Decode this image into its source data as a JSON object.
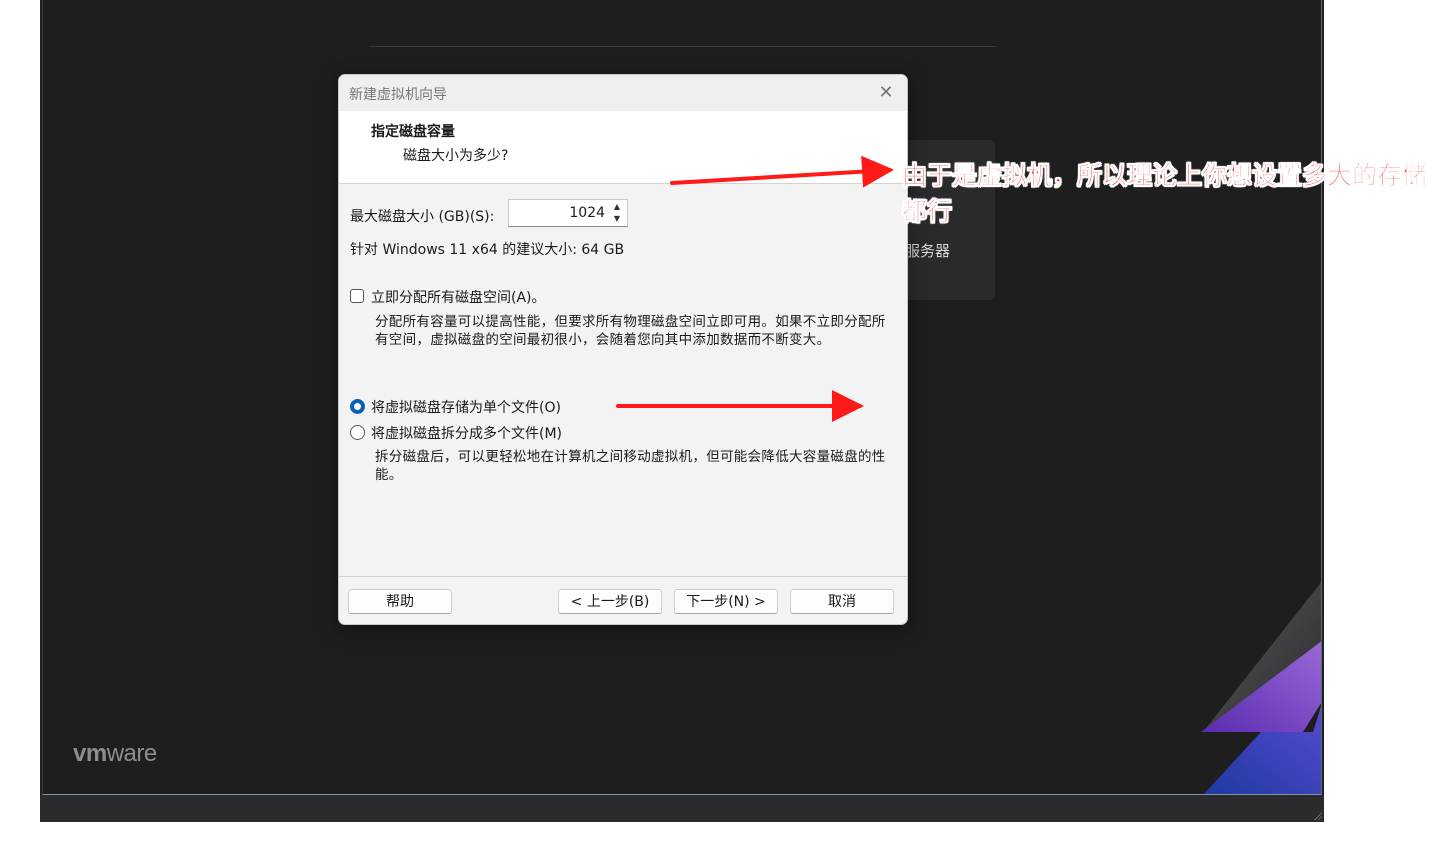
{
  "home": {
    "card_label": "服务器",
    "logo_light": "vm",
    "logo_rest": "ware"
  },
  "dialog": {
    "title": "新建虚拟机向导",
    "close_glyph": "✕",
    "header_title": "指定磁盘容量",
    "header_subtitle": "磁盘大小为多少?",
    "max_size_label": "最大磁盘大小 (GB)(S):",
    "max_size_value": "1024",
    "recommend_text": "针对 Windows 11 x64 的建议大小: 64 GB",
    "allocate_checkbox": {
      "label": "立即分配所有磁盘空间(A)。",
      "checked": false,
      "description": "分配所有容量可以提高性能，但要求所有物理磁盘空间立即可用。如果不立即分配所有空间，虚拟磁盘的空间最初很小，会随着您向其中添加数据而不断变大。"
    },
    "radio_single": {
      "label": "将虚拟磁盘存储为单个文件(O)",
      "selected": true
    },
    "radio_split": {
      "label": "将虚拟磁盘拆分成多个文件(M)",
      "selected": false,
      "description": "拆分磁盘后，可以更轻松地在计算机之间移动虚拟机，但可能会降低大容量磁盘的性能。"
    },
    "buttons": {
      "help": "帮助",
      "back": "< 上一步(B)",
      "next": "下一步(N) >",
      "cancel": "取消"
    }
  },
  "annotation": {
    "text": "由于是虚拟机，所以理论上你想设置多大的存储都行",
    "color": "#ff1a1a"
  },
  "colors": {
    "accent": "#0a5fb6",
    "vm_background": "#1e1e1f"
  }
}
